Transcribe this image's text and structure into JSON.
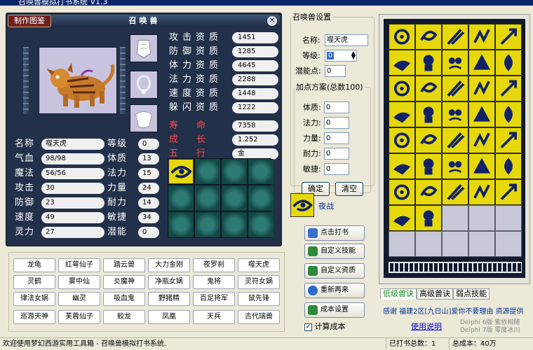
{
  "window": {
    "title": "召唤兽模拟打书系统 V1.3"
  },
  "panel": {
    "handbook_label": "制作图鉴",
    "title": "召唤兽",
    "close_icon": "close-icon",
    "stats": [
      {
        "label": "攻击资质",
        "value": "1451"
      },
      {
        "label": "防御资质",
        "value": "1285"
      },
      {
        "label": "体力资质",
        "value": "4645"
      },
      {
        "label": "法力资质",
        "value": "2288"
      },
      {
        "label": "速度资质",
        "value": "1448"
      },
      {
        "label": "躲闪资质",
        "value": "1222"
      }
    ],
    "growth": [
      {
        "label": "寿命",
        "value": "7358"
      },
      {
        "label": "成长",
        "value": "1.252"
      },
      {
        "label": "五行",
        "value": "金"
      }
    ],
    "info_left": [
      {
        "label": "名称",
        "value": "噬天虎"
      },
      {
        "label": "气血",
        "value": "98/98"
      },
      {
        "label": "魔法",
        "value": "56/56"
      },
      {
        "label": "攻击",
        "value": "30"
      },
      {
        "label": "防御",
        "value": "23"
      },
      {
        "label": "速度",
        "value": "49"
      },
      {
        "label": "灵力",
        "value": "27"
      }
    ],
    "info_right": [
      {
        "label": "等级",
        "value": "0"
      },
      {
        "label": "体质",
        "value": "13"
      },
      {
        "label": "法力",
        "value": "15"
      },
      {
        "label": "力量",
        "value": "24"
      },
      {
        "label": "耐力",
        "value": "14"
      },
      {
        "label": "敏捷",
        "value": "34"
      },
      {
        "label": "潜能",
        "value": "0"
      }
    ]
  },
  "beast_buttons": [
    "龙龟",
    "红萼仙子",
    "踏云兽",
    "大力金刚",
    "夜罗刹",
    "噬天虎",
    "灵鹤",
    "雾中仙",
    "炎魔神",
    "净瓶女娲",
    "鬼将",
    "灵符女娲",
    "律法女娲",
    "幽灵",
    "吸血鬼",
    "野猪精",
    "百足将军",
    "鼠先锋",
    "巡游天神",
    "芙蓉仙子",
    "蛟龙",
    "凤凰",
    "天兵",
    "古代瑞兽"
  ],
  "settings": {
    "group_title": "召唤兽设置",
    "name_label": "名称:",
    "name_value": "噬天虎",
    "level_label": "等级:",
    "level_value": "0",
    "potential_label": "潜能点:",
    "potential_value": "0",
    "plan_title": "加点方案(总数100)",
    "plan": [
      {
        "label": "体质:",
        "value": "0"
      },
      {
        "label": "法力:",
        "value": "0"
      },
      {
        "label": "力量:",
        "value": "0"
      },
      {
        "label": "耐力:",
        "value": "0"
      },
      {
        "label": "敏捷:",
        "value": "0"
      }
    ],
    "ok_label": "确定",
    "clear_label": "清空"
  },
  "selected_skill": {
    "name": "夜战",
    "icon": "eye-icon"
  },
  "actions": [
    {
      "label": "点击打书",
      "icon": "book-icon",
      "color": "#3a6ec8"
    },
    {
      "label": "自定义技能",
      "icon": "list-icon",
      "color": "#2c8a3a"
    },
    {
      "label": "自定义资质",
      "icon": "list-icon",
      "color": "#2c8a3a"
    },
    {
      "label": "重新再来",
      "icon": "refresh-icon",
      "color": "#2a6ad0"
    },
    {
      "label": "成本设置",
      "icon": "check-icon",
      "color": "#2c8a3a"
    }
  ],
  "cost_checkbox": {
    "label": "计算成本",
    "checked": true
  },
  "tabs": [
    "低级兽诀",
    "高级兽诀",
    "弱点技能"
  ],
  "thanks_text": "感谢 福建2区[九日山]爱你不要理由 资源提供",
  "help_link": "使用说明",
  "credits": [
    "Delphi 6版 紫依相随",
    "Delphi 7版 零度冰川"
  ],
  "status": {
    "welcome": "欢迎使用梦幻西游实用工具箱 - 召唤兽模拟打书系统.",
    "books": "已打书总数：1",
    "total_cost": "总成本：40万"
  },
  "colors": {
    "panel_bg": "#22304a",
    "skill_yellow": "#e6d80a",
    "accent_red": "#ff4848"
  }
}
